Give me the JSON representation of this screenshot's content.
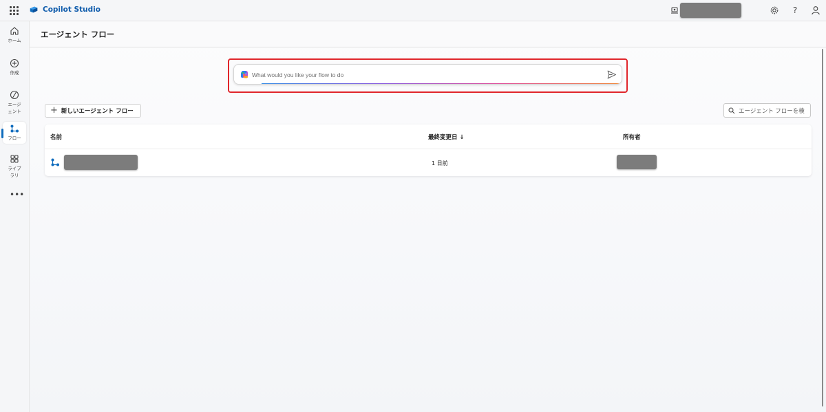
{
  "app": {
    "name": "Copilot Studio",
    "brand_color": "#0f5cac",
    "accent": "#0f6cbd"
  },
  "topbar": {
    "icons": [
      "app-launcher-icon",
      "environment-icon",
      "settings-icon",
      "help-icon",
      "account-icon"
    ],
    "help_glyph": "?"
  },
  "rail": {
    "items": [
      {
        "label": "ホーム",
        "icon": "home-icon"
      },
      {
        "label": "作成",
        "icon": "create-icon"
      },
      {
        "label": "エージ\nェント",
        "icon": "agents-icon"
      },
      {
        "label": "フロー",
        "icon": "flows-icon",
        "active": true
      },
      {
        "label": "ライブ\nラリ",
        "icon": "library-icon"
      }
    ],
    "more_label": "•••"
  },
  "page": {
    "title": "エージェント フロー"
  },
  "prompt": {
    "placeholder": "What would you like your flow to do",
    "highlight_color": "#e0262b"
  },
  "toolbar": {
    "new_button_label": "新しいエージェント フロー",
    "search_placeholder": "エージェント フローを検"
  },
  "table": {
    "columns": [
      "名前",
      "最終変更日 ↓",
      "所有者"
    ],
    "rows": [
      {
        "name": "",
        "modified": "1 日前",
        "owner": ""
      }
    ]
  }
}
